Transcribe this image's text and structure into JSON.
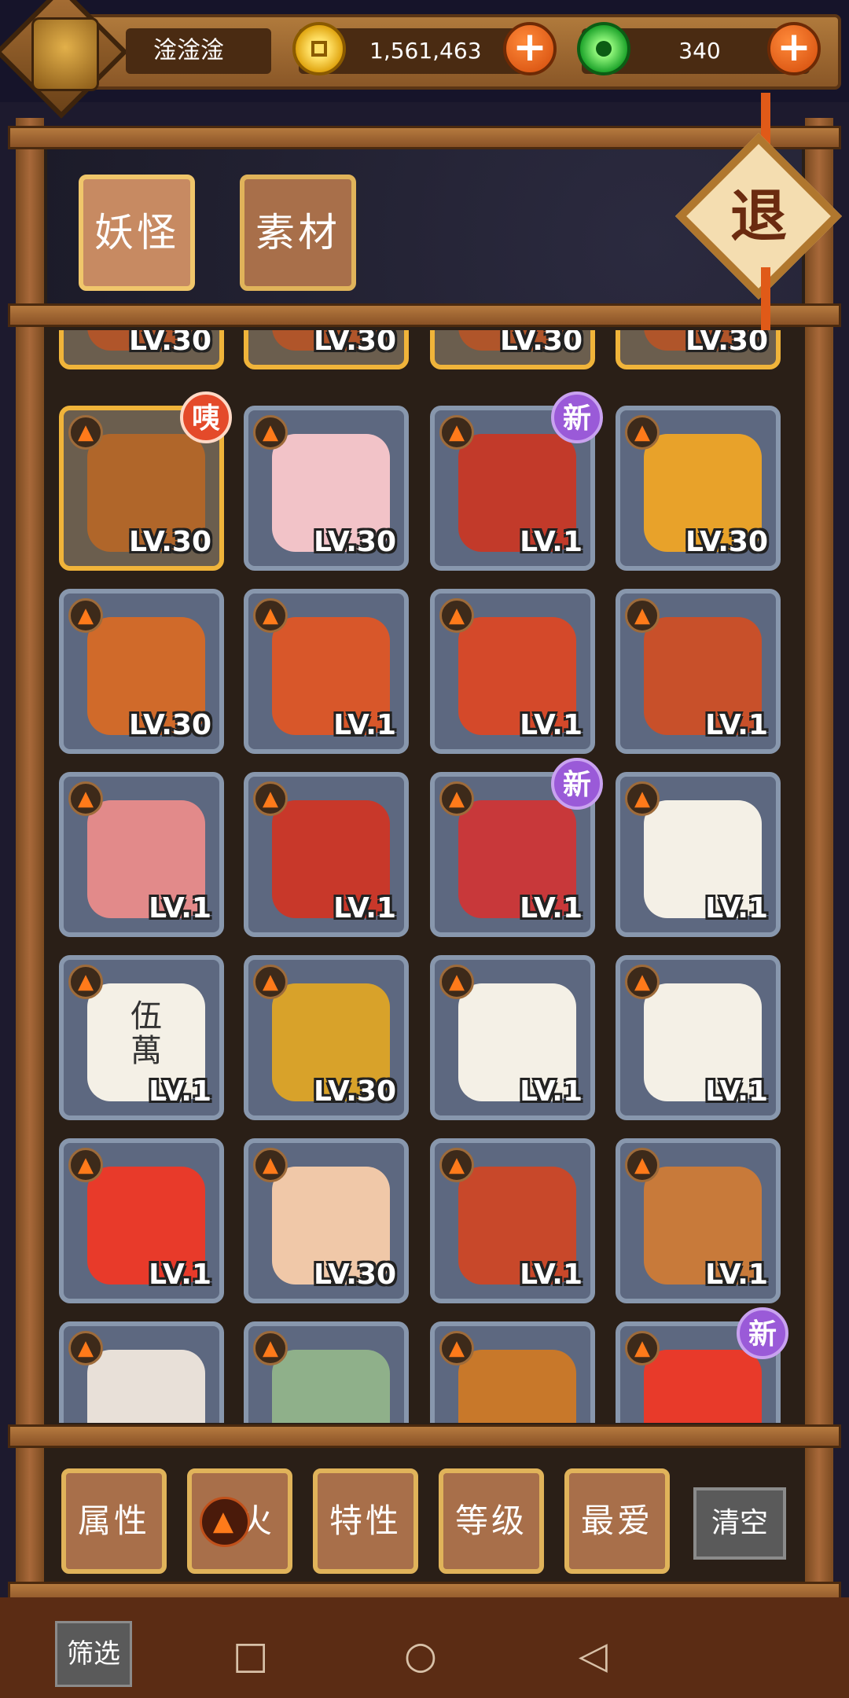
{
  "topbar": {
    "player_name": "淦淦淦",
    "coins": "1,561,463",
    "gems": "340",
    "plus_label": "+"
  },
  "tabs": [
    {
      "label": "妖怪",
      "active": true
    },
    {
      "label": "素材",
      "active": false
    }
  ],
  "exit_label": "退",
  "grid": {
    "partial_top_row": [
      "LV.30",
      "LV.30",
      "LV.30",
      "LV.30"
    ],
    "items": [
      {
        "level": "LV.30",
        "badge": "咦",
        "gold": true,
        "color": "#b0662a"
      },
      {
        "level": "LV.30",
        "badge": "",
        "gold": false,
        "color": "#f2c3c8"
      },
      {
        "level": "LV.1",
        "badge": "新",
        "gold": false,
        "color": "#c23a2a"
      },
      {
        "level": "LV.30",
        "badge": "",
        "gold": false,
        "color": "#e8a22a"
      },
      {
        "level": "LV.30",
        "badge": "",
        "gold": false,
        "color": "#d06a2a"
      },
      {
        "level": "LV.1",
        "badge": "",
        "gold": false,
        "color": "#d8572a"
      },
      {
        "level": "LV.1",
        "badge": "",
        "gold": false,
        "color": "#d4492a"
      },
      {
        "level": "LV.1",
        "badge": "",
        "gold": false,
        "color": "#c8502a"
      },
      {
        "level": "LV.1",
        "badge": "",
        "gold": false,
        "color": "#e28a8a"
      },
      {
        "level": "LV.1",
        "badge": "",
        "gold": false,
        "color": "#c8382a"
      },
      {
        "level": "LV.1",
        "badge": "新",
        "gold": false,
        "color": "#c8383a"
      },
      {
        "level": "LV.1",
        "badge": "",
        "gold": false,
        "color": "#f4f0e6"
      },
      {
        "level": "LV.1",
        "badge": "",
        "gold": false,
        "color": "#f4f0e6",
        "tile_text": "伍萬"
      },
      {
        "level": "LV.30",
        "badge": "",
        "gold": false,
        "color": "#d8a22a"
      },
      {
        "level": "LV.1",
        "badge": "",
        "gold": false,
        "color": "#f4f0e6"
      },
      {
        "level": "LV.1",
        "badge": "",
        "gold": false,
        "color": "#f4f0e6"
      },
      {
        "level": "LV.1",
        "badge": "",
        "gold": false,
        "color": "#e83a2a"
      },
      {
        "level": "LV.30",
        "badge": "",
        "gold": false,
        "color": "#f0c8a8"
      },
      {
        "level": "LV.1",
        "badge": "",
        "gold": false,
        "color": "#c8482a"
      },
      {
        "level": "LV.1",
        "badge": "",
        "gold": false,
        "color": "#c87a3a"
      },
      {
        "level": "",
        "badge": "",
        "gold": false,
        "color": "#e8e0d8"
      },
      {
        "level": "",
        "badge": "",
        "gold": false,
        "color": "#8fb08a"
      },
      {
        "level": "",
        "badge": "",
        "gold": false,
        "color": "#c8782a"
      },
      {
        "level": "",
        "badge": "新",
        "gold": false,
        "color": "#e83a2a"
      }
    ]
  },
  "filters": [
    {
      "label": "属性"
    },
    {
      "label": "火",
      "icon": "fire-icon"
    },
    {
      "label": "特性"
    },
    {
      "label": "等级"
    },
    {
      "label": "最爱"
    }
  ],
  "clear_label": "清空",
  "screen_filter_label": "筛选",
  "nav": {
    "recents": "□",
    "home": "○",
    "back": "◁"
  },
  "colors": {
    "wood": "#a86f4a",
    "gold_border": "#e0b35a",
    "fire": "#ff7a1a",
    "new_badge": "#9a5ad8"
  }
}
